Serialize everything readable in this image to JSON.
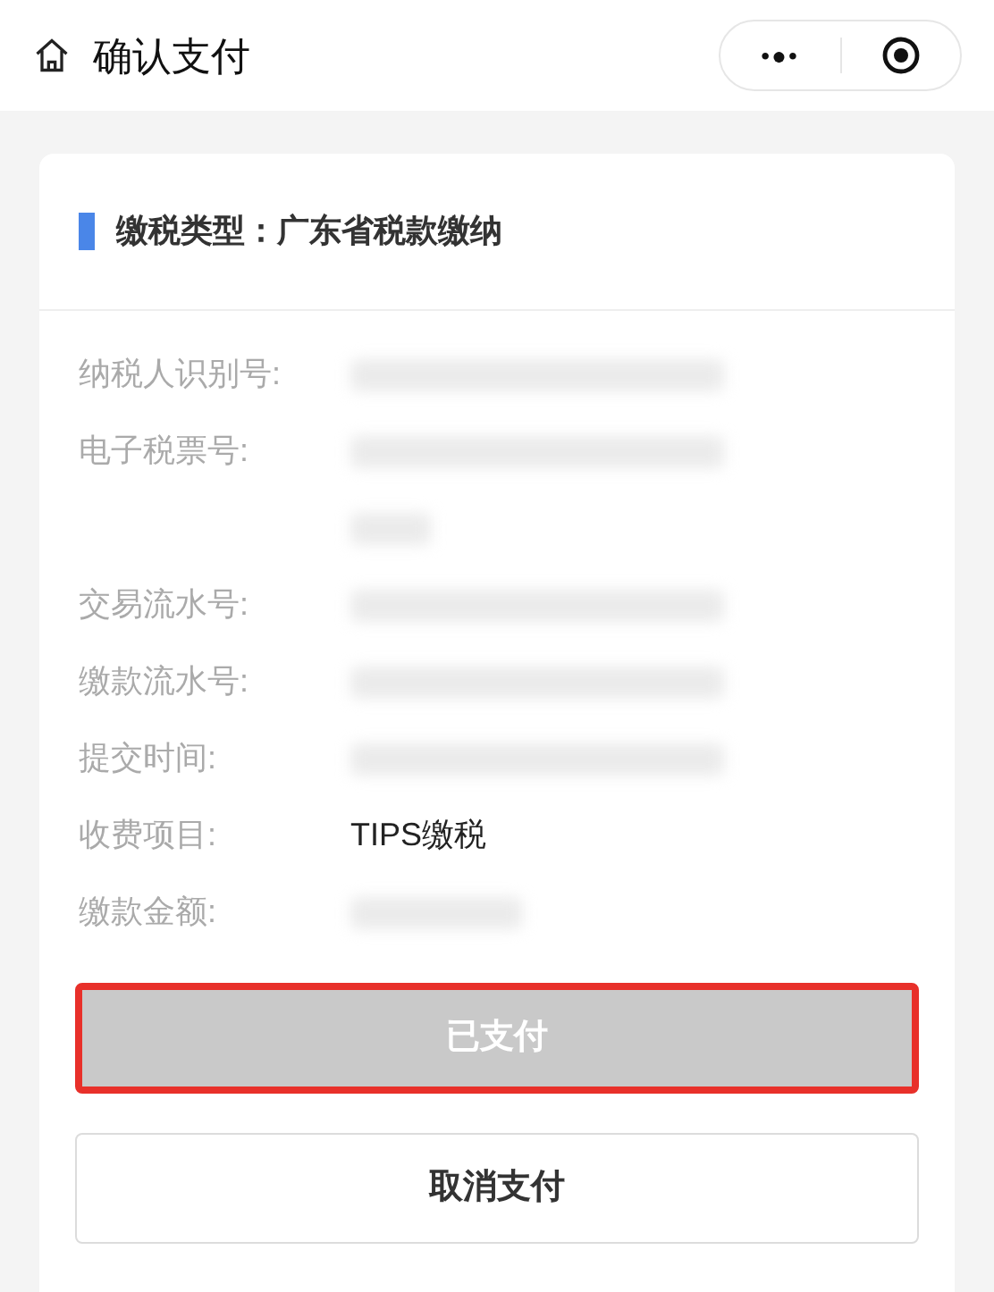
{
  "nav": {
    "title": "确认支付",
    "more_icon": "•●•"
  },
  "section": {
    "title": "缴税类型：广东省税款缴纳"
  },
  "rows": [
    {
      "label": "纳税人识别号:",
      "kind": "redacted"
    },
    {
      "label": "电子税票号:",
      "kind": "redacted_double"
    },
    {
      "label": "交易流水号:",
      "kind": "redacted"
    },
    {
      "label": "缴款流水号:",
      "kind": "redacted"
    },
    {
      "label": "提交时间:",
      "kind": "redacted"
    },
    {
      "label": "收费项目:",
      "kind": "text",
      "value": "TIPS缴税"
    },
    {
      "label": "缴款金额:",
      "kind": "redacted_short"
    }
  ],
  "buttons": [
    {
      "label": "已支付",
      "disabled": true,
      "highlighted": true
    },
    {
      "label": "取消支付",
      "disabled": false,
      "highlighted": false
    }
  ]
}
